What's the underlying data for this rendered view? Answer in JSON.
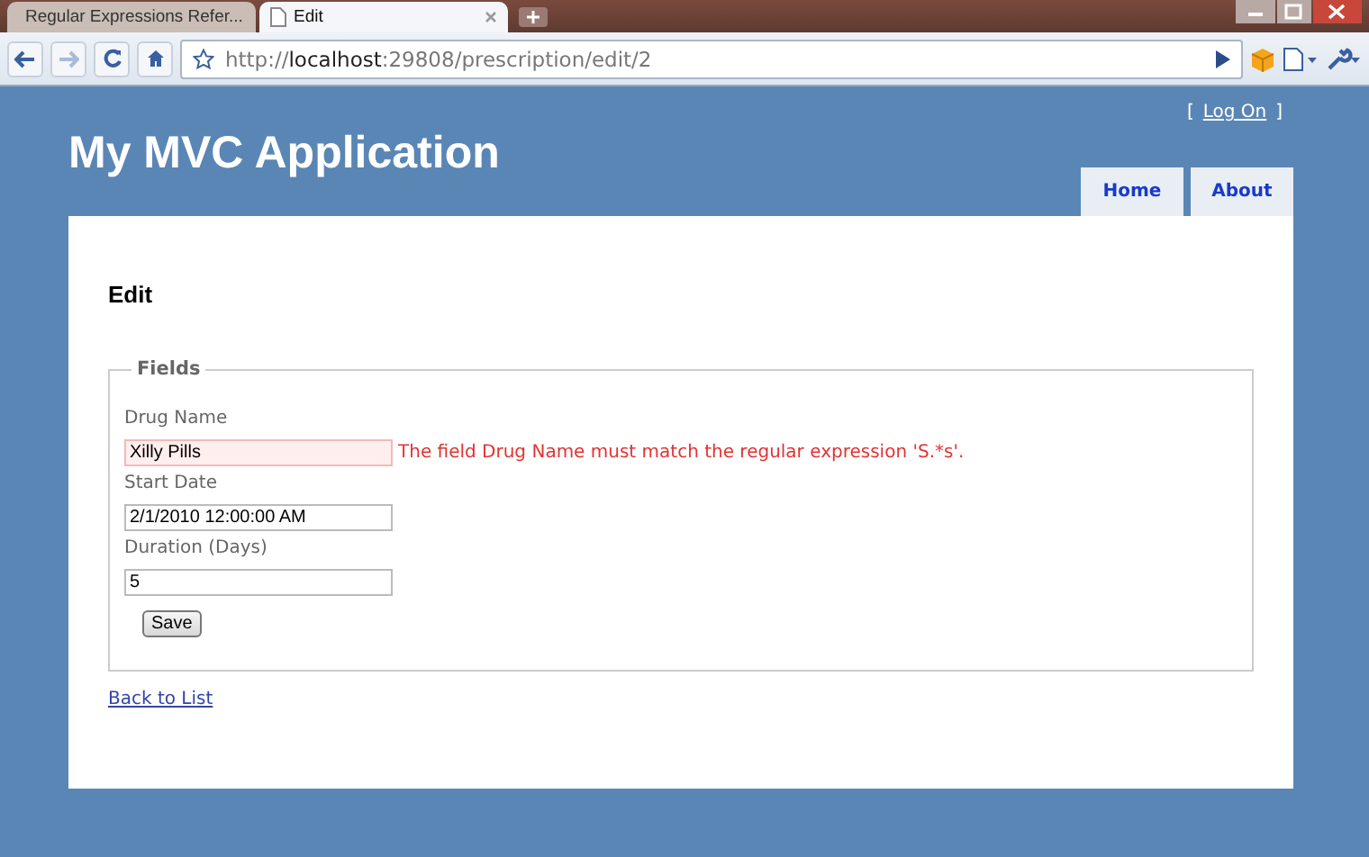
{
  "browser": {
    "tabs": [
      {
        "title": "Regular Expressions Refer...",
        "selected": false
      },
      {
        "title": "Edit",
        "selected": true
      }
    ],
    "url": {
      "scheme": "http://",
      "host": "localhost",
      "path": ":29808/prescription/edit/2"
    }
  },
  "header": {
    "title": "My MVC Application",
    "login": {
      "open": "[",
      "link": "Log On",
      "close": "]"
    },
    "menu": [
      {
        "label": "Home"
      },
      {
        "label": "About"
      }
    ]
  },
  "page": {
    "heading": "Edit",
    "legend": "Fields",
    "fields": [
      {
        "label": "Drug Name",
        "value": "Xilly Pills",
        "invalid": true,
        "error": "The field Drug Name must match the regular expression 'S.*s'."
      },
      {
        "label": "Start Date",
        "value": "2/1/2010 12:00:00 AM",
        "invalid": false
      },
      {
        "label": "Duration (Days)",
        "value": "5",
        "invalid": false
      }
    ],
    "button": "Save",
    "back_link": "Back to List"
  }
}
